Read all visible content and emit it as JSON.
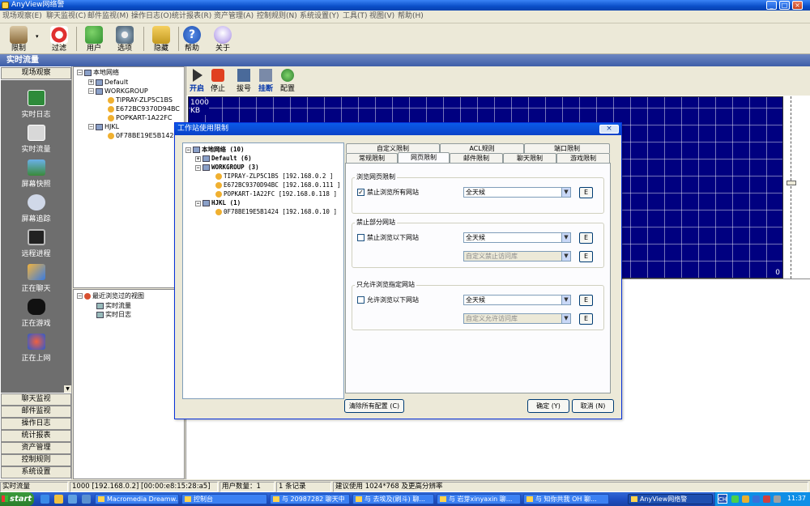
{
  "window": {
    "title": "AnyView网络警"
  },
  "menu": [
    "现场观察(E)",
    "聊天监视(C)",
    "邮件监视(M)",
    "操作日志(O)",
    "统计报表(R)",
    "资产管理(A)",
    "控制规则(N)",
    "系统设置(Y)",
    "工具(T)",
    "视图(V)",
    "帮助(H)"
  ],
  "toolbar": {
    "limit": "限制",
    "filter": "过滤",
    "user": "用户",
    "options": "选项",
    "hide": "隐藏",
    "help": "帮助",
    "about": "关于"
  },
  "section_title": "实时流量",
  "leftnav": {
    "top": "现场观察",
    "items": [
      "实时日志",
      "实时流量",
      "屏幕快照",
      "屏幕追踪",
      "远程进程",
      "正在聊天",
      "正在游戏",
      "正在上网"
    ],
    "buttons": [
      "聊天监视",
      "邮件监视",
      "操作日志",
      "统计报表",
      "资产管理",
      "控制规则",
      "系统设置"
    ]
  },
  "tree": {
    "root": "本地网络",
    "default": "Default",
    "workgroup": "WORKGROUP",
    "wg_hosts": [
      "TIPRAY-ZLP5C1BS",
      "E672BC9370D94BC",
      "POPKART-1A22FC"
    ],
    "hjkl": "HJKL",
    "hjkl_hosts": [
      "0F78BE19E5B1424"
    ]
  },
  "views": {
    "root": "最近浏览过的视图",
    "items": [
      "实时流量",
      "实时日志"
    ]
  },
  "rtool": {
    "start": "开启",
    "stop": "停止",
    "dial": "拔号",
    "hangup": "挂断",
    "config": "配置"
  },
  "graph": {
    "max": "1000",
    "unit": "KB",
    "zero": "0"
  },
  "status": {
    "panel": "实时流量",
    "host": "1000 [192.168.0.2] [00:00:e8:15:28:a5]",
    "users": "用户数量：1",
    "records": "1 条记录",
    "hint": "建议使用 1024*768 及更高分辨率"
  },
  "taskbar": {
    "start": "start",
    "buttons": [
      "Macromedia Dreamw...",
      "控制台",
      "与 20987282 聊天中",
      "与 去埃及(刷斗) 聊...",
      "与 岩芽xinyaxin 聊...",
      "与 知你共我 OH 聊...",
      "AnyView网络警"
    ],
    "ime": "CH",
    "clock": "11:37"
  },
  "dialog": {
    "title": "工作站使用限制",
    "close": "×",
    "tree": {
      "root": "本地网络 (10)",
      "default": "Default (6)",
      "workgroup": "WORKGROUP (3)",
      "wg_hosts": [
        "TIPRAY-ZLP5C1BS [192.168.0.2    ]",
        "E672BC9370D94BC [192.168.0.111  ]",
        "POPKART-1A22FC  [192.168.0.118  ]"
      ],
      "hjkl": "HJKL (1)",
      "hjkl_hosts": [
        "0F78BE19E5B1424 [192.168.0.10   ]"
      ]
    },
    "tabs_row1": [
      "自定义限制",
      "ACL规则",
      "端口限制"
    ],
    "tabs_row2": [
      "常规限制",
      "网页限制",
      "邮件限制",
      "聊天限制",
      "游戏限制"
    ],
    "group1": {
      "title": "浏览网页限制",
      "label": "禁止浏览所有网站",
      "checked": true,
      "time": "全天候",
      "e": "E"
    },
    "group2": {
      "title": "禁止部分网站",
      "label": "禁止浏览以下网站",
      "checked": false,
      "time": "全天候",
      "lib": "自定义禁止访问库",
      "e": "E"
    },
    "group3": {
      "title": "只允许浏览指定网站",
      "label": "允许浏览以下网站",
      "checked": false,
      "time": "全天候",
      "lib": "自定义允许访问库",
      "e": "E"
    },
    "clear": "清除所有配置 (C)",
    "ok": "确定 (Y)",
    "cancel": "取消 (N)"
  }
}
